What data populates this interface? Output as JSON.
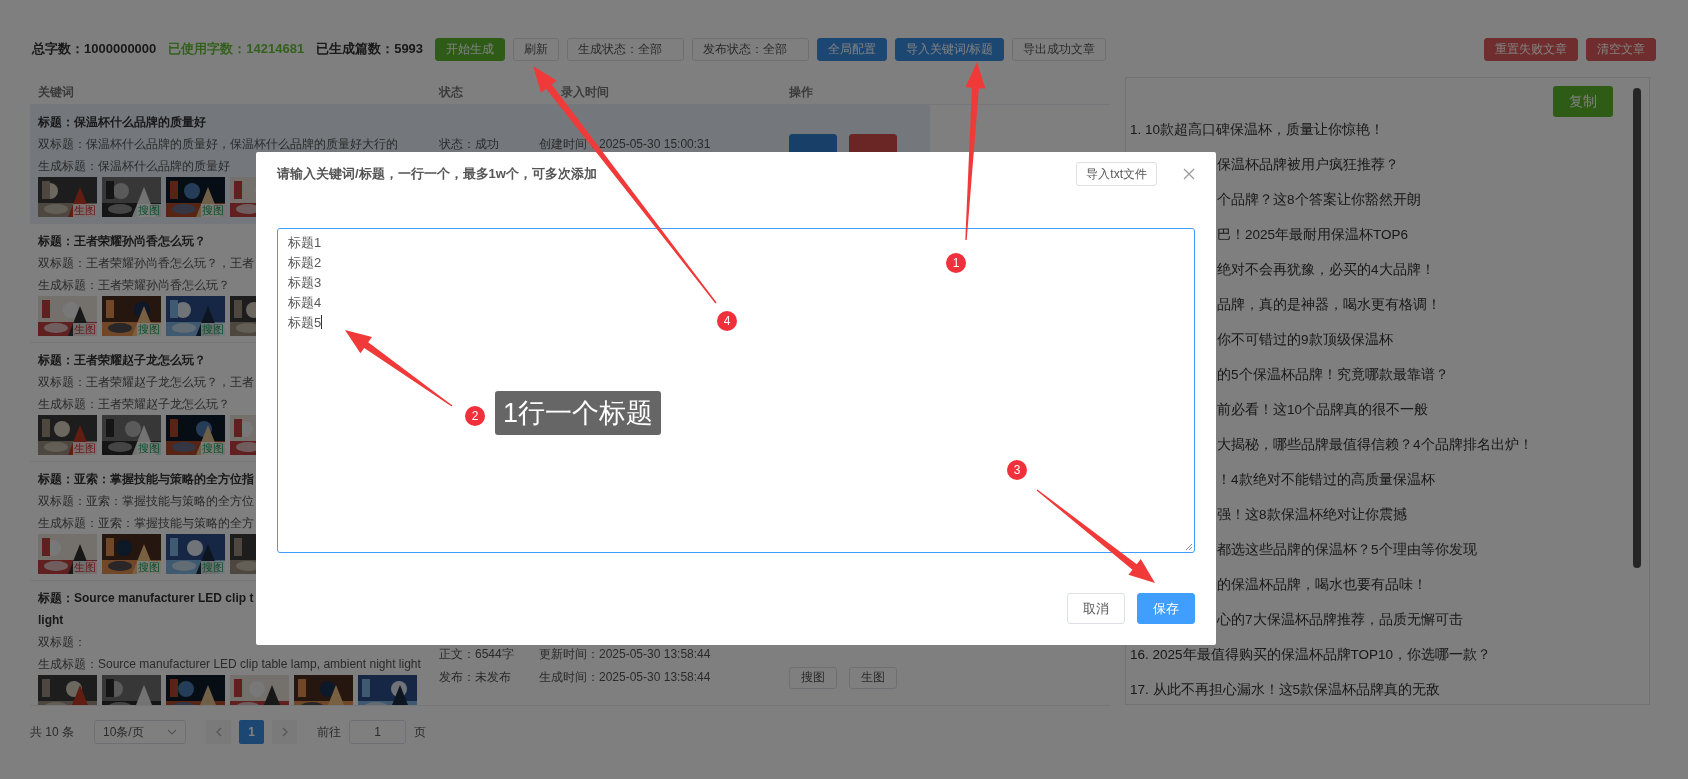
{
  "stats": [
    {
      "label": "总字数：1000000000",
      "kind": "total"
    },
    {
      "label": "已使用字数：14214681",
      "kind": "used"
    },
    {
      "label": "已生成篇数：5993",
      "kind": "total"
    }
  ],
  "toolbar": [
    {
      "label": "开始生成",
      "kind": "success"
    },
    {
      "label": "刷新",
      "kind": "plain"
    },
    {
      "label": "生成状态：全部",
      "kind": "select"
    },
    {
      "label": "发布状态：全部",
      "kind": "select"
    },
    {
      "label": "全局配置",
      "kind": "primary"
    },
    {
      "label": "导入关键词/标题",
      "kind": "primary"
    },
    {
      "label": "导出成功文章",
      "kind": "plain"
    }
  ],
  "toolbar_right": [
    {
      "label": "重置失败文章",
      "kind": "danger"
    },
    {
      "label": "清空文章",
      "kind": "danger"
    }
  ],
  "table": {
    "columns": [
      "关键词",
      "状态",
      "录入时间",
      "操作"
    ],
    "rows": [
      {
        "highlighted": true,
        "title_lines": [
          "标题：保温杯什么品牌的质量好"
        ],
        "double_title": "双标题：保温杯什么品牌的质量好，保温杯什么品牌的质量好大行的",
        "generated_title": "生成标题：保温杯什么品牌的质量好",
        "images": [
          {
            "tag": "生图",
            "kind": "generated"
          },
          {
            "tag": "搜图",
            "kind": "searched"
          },
          {
            "tag": "搜图",
            "kind": "searched"
          },
          {
            "kind": "picture"
          }
        ],
        "status_lines": [
          [
            "状态：成功",
            "创建时间：2025-05-30 15:00:31"
          ]
        ],
        "actions": [
          {
            "kind": "primary"
          },
          {
            "kind": "danger"
          }
        ]
      },
      {
        "highlighted": false,
        "title_lines": [
          "标题：王者荣耀孙尚香怎么玩？"
        ],
        "double_title": "双标题：王者荣耀孙尚香怎么玩？，王者",
        "generated_title": "生成标题：王者荣耀孙尚香怎么玩？",
        "images": [
          {
            "tag": "生图",
            "kind": "generated"
          },
          {
            "tag": "搜图",
            "kind": "searched"
          },
          {
            "tag": "搜图",
            "kind": "searched"
          },
          {
            "kind": "picture"
          }
        ]
      },
      {
        "highlighted": false,
        "title_lines": [
          "标题：王者荣耀赵子龙怎么玩？"
        ],
        "double_title": "双标题：王者荣耀赵子龙怎么玩？，王者",
        "generated_title": "生成标题：王者荣耀赵子龙怎么玩？",
        "images": [
          {
            "tag": "生图",
            "kind": "generated"
          },
          {
            "tag": "搜图",
            "kind": "searched"
          },
          {
            "tag": "搜图",
            "kind": "searched"
          },
          {
            "kind": "picture"
          }
        ]
      },
      {
        "highlighted": false,
        "title_lines": [
          "标题：亚索：掌握技能与策略的全方位指"
        ],
        "double_title": "双标题：亚索：掌握技能与策略的全方位",
        "generated_title": "生成标题：亚索：掌握技能与策略的全方",
        "images": [
          {
            "tag": "生图",
            "kind": "generated"
          },
          {
            "tag": "搜图",
            "kind": "searched"
          },
          {
            "tag": "搜图",
            "kind": "searched"
          },
          {
            "kind": "picture"
          }
        ]
      },
      {
        "highlighted": false,
        "title_lines": [
          "标题：Source manufacturer LED clip t",
          "light"
        ],
        "double_title": "双标题：",
        "generated_title": "生成标题：Source manufacturer LED clip table lamp, ambient night light",
        "images": [
          {
            "kind": "picture"
          },
          {
            "kind": "picture"
          },
          {
            "kind": "picture"
          },
          {
            "kind": "picture"
          },
          {
            "kind": "picture"
          },
          {
            "kind": "picture"
          }
        ],
        "status_lines": [
          [
            "正文：6544字",
            "更新时间：2025-05-30 13:58:44"
          ],
          [
            "发布：未发布",
            "生成时间：2025-05-30 13:58:44"
          ]
        ],
        "actions": [
          {
            "label": "搜图",
            "kind": "plain"
          },
          {
            "label": "生图",
            "kind": "plain"
          }
        ]
      }
    ]
  },
  "pagination": {
    "total": "共 10 条",
    "page_size": "10条/页",
    "pages": [
      {
        "label": "1",
        "selected": true
      }
    ],
    "goto_label": "前往",
    "goto_value": "1",
    "goto_suffix": "页"
  },
  "result_panel": {
    "copy_button": "复制",
    "items": [
      {
        "text": "1. 10款超高口碑保温杯，质量让你惊艳！",
        "covered": false
      },
      {
        "text": "保温杯品牌被用户疯狂推荐？",
        "covered": true
      },
      {
        "text": "个品牌？这8个答案让你豁然开朗",
        "covered": true
      },
      {
        "text": "巴！2025年最耐用保温杯TOP6",
        "covered": true
      },
      {
        "text": "绝对不会再犹豫，必买的4大品牌！",
        "covered": true
      },
      {
        "text": "品牌，真的是神器，喝水更有格调！",
        "covered": true
      },
      {
        "text": "你不可错过的9款顶级保温杯",
        "covered": true
      },
      {
        "text": "的5个保温杯品牌！究竟哪款最靠谱？",
        "covered": true
      },
      {
        "text": "前必看！这10个品牌真的很不一般",
        "covered": true
      },
      {
        "text": "大揭秘，哪些品牌最值得信赖？4个品牌排名出炉！",
        "covered": true
      },
      {
        "text": "！4款绝对不能错过的高质量保温杯",
        "covered": true
      },
      {
        "text": "强！这8款保温杯绝对让你震撼",
        "covered": true
      },
      {
        "text": "都选这些品牌的保温杯？5个理由等你发现",
        "covered": true
      },
      {
        "text": "的保温杯品牌，喝水也要有品味！",
        "covered": true
      },
      {
        "text": "心的7大保温杯品牌推荐，品质无懈可击",
        "covered": true
      },
      {
        "text": "16. 2025年最值得购买的保温杯品牌TOP10，你选哪一款？",
        "covered": false
      },
      {
        "text": "17. 从此不再担心漏水！这5款保温杯品牌真的无敌",
        "covered": false
      }
    ]
  },
  "modal": {
    "title": "请输入关键词/标题，一行一个，最多1w个，可多次添加",
    "import_button": "导入txt文件",
    "field": {
      "value": "标题1\n标题2\n标题3\n标题4\n标题5",
      "focused": true
    },
    "buttons": [
      {
        "label": "取消",
        "kind": "plain"
      },
      {
        "label": "保存",
        "kind": "primary"
      }
    ]
  },
  "annotations": [
    {
      "number": "1"
    },
    {
      "number": "2",
      "callout": "1行一个标题"
    },
    {
      "number": "3"
    },
    {
      "number": "4"
    }
  ]
}
